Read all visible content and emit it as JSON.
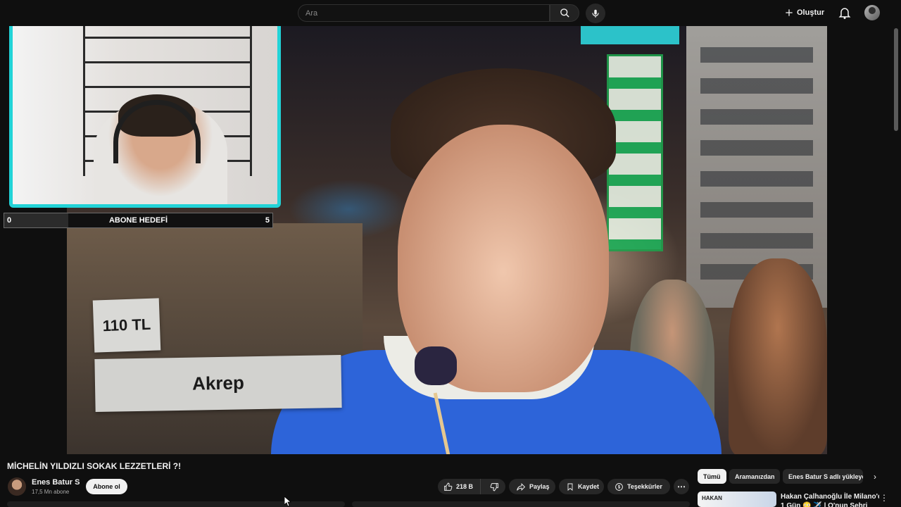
{
  "header": {
    "search_placeholder": "Ara",
    "create_label": "Oluştur",
    "icons": [
      "search-icon",
      "mic-icon",
      "plus-icon",
      "bell-icon",
      "avatar"
    ]
  },
  "overlay": {
    "subscriber_goal": {
      "label": "ABONE HEDEFİ",
      "min": "0",
      "max": "5",
      "progress_fraction": 0.24
    },
    "facecam_border_color": "#22d3d7"
  },
  "video_captions": {
    "price": "110 TL",
    "item": "Akrep"
  },
  "video": {
    "title": "MİCHELİN YILDIZLI SOKAK LEZZETLERİ ?!",
    "channel_name": "Enes Batur S",
    "channel_subs": "17,5 Mn abone",
    "subscribe_label": "Abone ol",
    "like_count": "218 B",
    "share_label": "Paylaş",
    "save_label": "Kaydet",
    "thanks_label": "Teşekkürler",
    "more_label": "⋯"
  },
  "sidebar": {
    "chips": [
      {
        "label": "Tümü",
        "active": true
      },
      {
        "label": "Aramanızdan",
        "active": false
      },
      {
        "label": "Enes Batur S adlı yükleyen",
        "active": false
      }
    ],
    "recommendation": {
      "thumb_text": "HAKAN",
      "title_line1": "Hakan Çalhanoğlu İle Milano'da",
      "title_line2": "1 Gün 😳 ✈️ | O'nun Şehri"
    }
  },
  "colors": {
    "background": "#0f0f0f",
    "pill": "#272727",
    "text": "#f1f1f1"
  }
}
